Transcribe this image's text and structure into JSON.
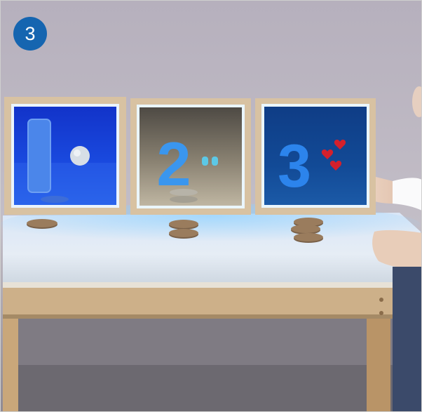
{
  "badge": {
    "number": "3",
    "color": "#1565b0"
  },
  "panels": [
    {
      "digit": "1",
      "glow": "#1e4dd8",
      "counters": 1
    },
    {
      "digit": "2",
      "glow": "#4fb3ff",
      "counters": 2
    },
    {
      "digit": "3",
      "glow": "#1a7fd0",
      "counters": 3
    }
  ],
  "colors": {
    "wall": "#b9b4be",
    "table_top": "#dfe8f3",
    "wood": "#c8a77c",
    "digit_blue": "#2f7fe8",
    "heart": "#d4202c"
  }
}
